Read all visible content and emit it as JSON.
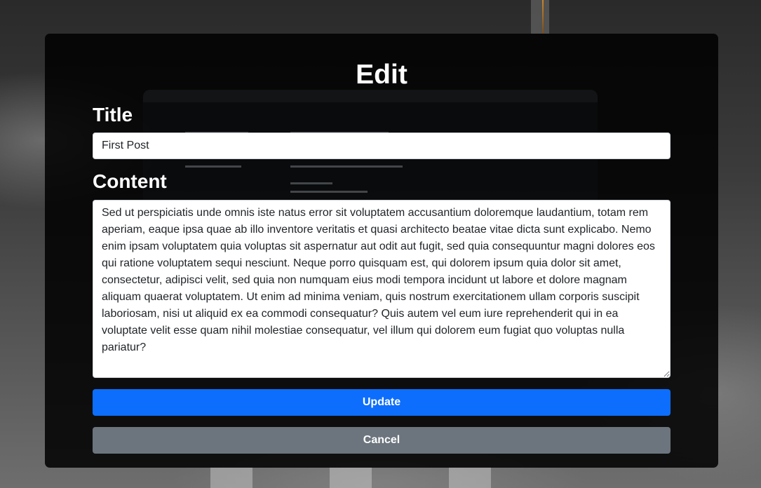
{
  "form": {
    "heading": "Edit",
    "title_label": "Title",
    "title_value": "First Post",
    "content_label": "Content",
    "content_value": "Sed ut perspiciatis unde omnis iste natus error sit voluptatem accusantium doloremque laudantium, totam rem aperiam, eaque ipsa quae ab illo inventore veritatis et quasi architecto beatae vitae dicta sunt explicabo. Nemo enim ipsam voluptatem quia voluptas sit aspernatur aut odit aut fugit, sed quia consequuntur magni dolores eos qui ratione voluptatem sequi nesciunt. Neque porro quisquam est, qui dolorem ipsum quia dolor sit amet, consectetur, adipisci velit, sed quia non numquam eius modi tempora incidunt ut labore et dolore magnam aliquam quaerat voluptatem. Ut enim ad minima veniam, quis nostrum exercitationem ullam corporis suscipit laboriosam, nisi ut aliquid ex ea commodi consequatur? Quis autem vel eum iure reprehenderit qui in ea voluptate velit esse quam nihil molestiae consequatur, vel illum qui dolorem eum fugiat quo voluptas nulla pariatur?",
    "update_label": "Update",
    "cancel_label": "Cancel"
  },
  "colors": {
    "primary": "#0d6efd",
    "secondary": "#6c757d",
    "card_background": "rgba(0,0,0,0.86)",
    "text": "#ffffff"
  }
}
